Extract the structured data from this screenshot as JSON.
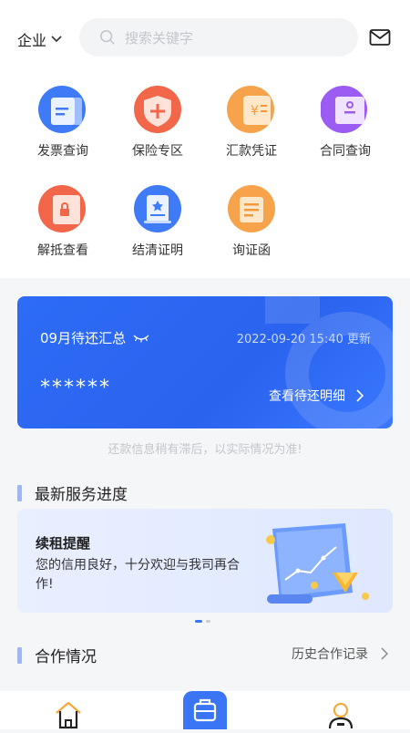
{
  "header": {
    "enterprise_label": "企业",
    "search_placeholder": "搜索关键字"
  },
  "services": [
    {
      "label": "发票查询",
      "icon": "invoice-icon"
    },
    {
      "label": "保险专区",
      "icon": "insurance-shield-icon"
    },
    {
      "label": "汇款凭证",
      "icon": "remittance-voucher-icon"
    },
    {
      "label": "合同查询",
      "icon": "contract-icon"
    },
    {
      "label": "解抵查看",
      "icon": "release-mortgage-icon"
    },
    {
      "label": "结清证明",
      "icon": "settlement-certificate-icon"
    },
    {
      "label": "询证函",
      "icon": "confirmation-letter-icon"
    }
  ],
  "summary_card": {
    "title": "09月待还汇总",
    "updated": "2022-09-20 15:40 更新",
    "amount": "******",
    "detail_link": "查看待还明细",
    "hint": "还款信息稍有滞后，以实际情况为准!"
  },
  "progress_section": {
    "title": "最新服务进度",
    "promo_title": "续租提醒",
    "promo_text": "您的信用良好，十分欢迎与我司再合作!",
    "carousel_index": 0,
    "carousel_count": 2
  },
  "cooperation_section": {
    "title": "合作情况",
    "more_link": "历史合作记录"
  },
  "tabbar": {
    "items": [
      "home-icon",
      "briefcase-icon",
      "user-icon"
    ],
    "active": "briefcase-icon"
  },
  "colors": {
    "primary": "#2d6cf6",
    "section_bar": "#9bb5ff"
  }
}
